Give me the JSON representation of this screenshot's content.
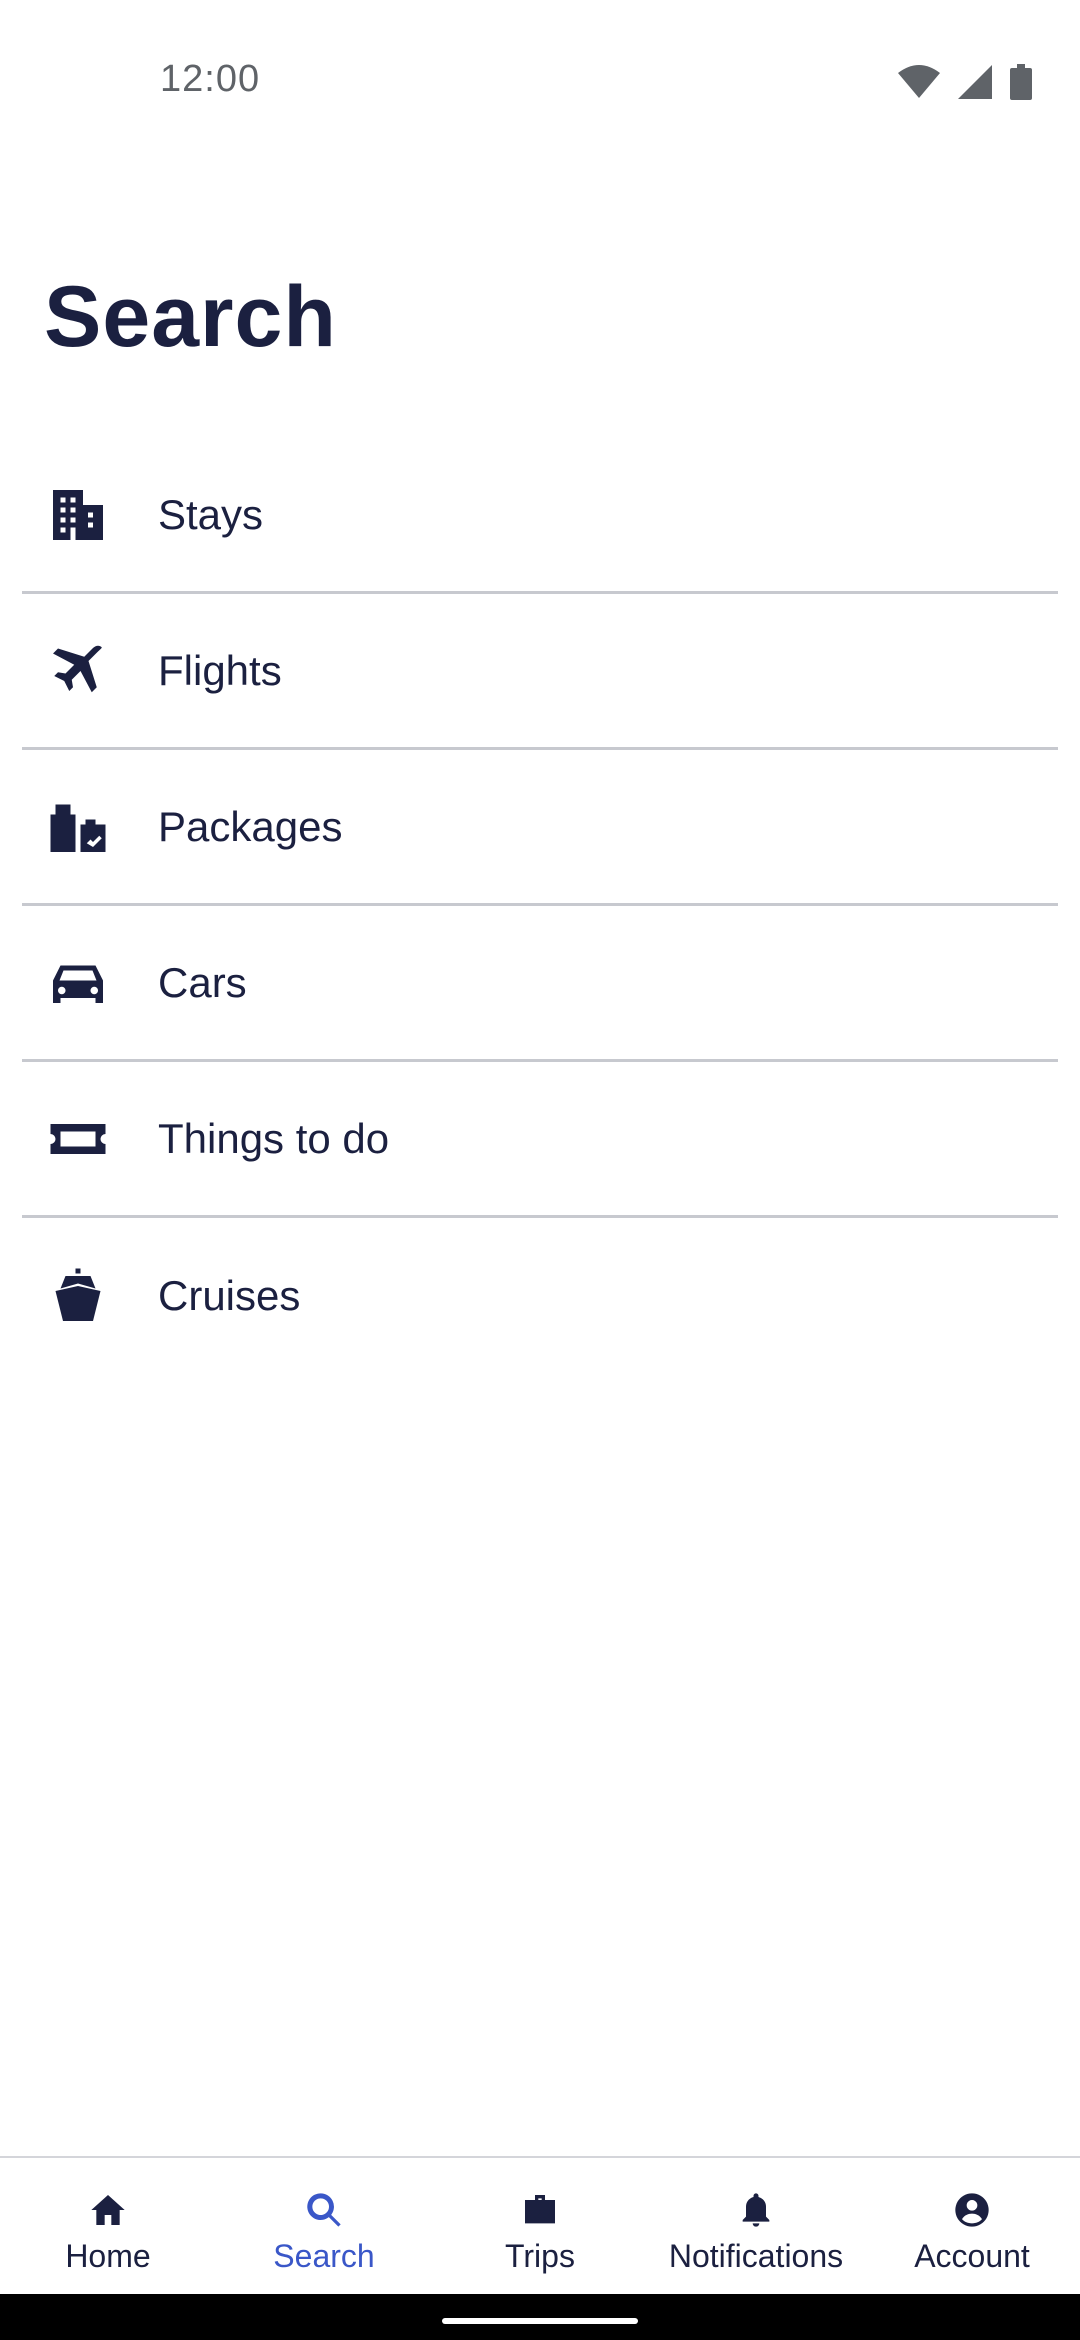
{
  "status_bar": {
    "time": "12:00",
    "icons": [
      "wifi-icon",
      "cellular-signal-icon",
      "battery-icon"
    ]
  },
  "page": {
    "title": "Search"
  },
  "search_options": [
    {
      "label": "Stays",
      "icon": "building-icon"
    },
    {
      "label": "Flights",
      "icon": "airplane-icon"
    },
    {
      "label": "Packages",
      "icon": "package-icon"
    },
    {
      "label": "Cars",
      "icon": "car-icon"
    },
    {
      "label": "Things to do",
      "icon": "ticket-icon"
    },
    {
      "label": "Cruises",
      "icon": "ship-icon"
    }
  ],
  "bottom_nav": {
    "items": [
      {
        "label": "Home",
        "icon": "home-icon"
      },
      {
        "label": "Search",
        "icon": "search-icon",
        "active": true
      },
      {
        "label": "Trips",
        "icon": "briefcase-icon"
      },
      {
        "label": "Notifications",
        "icon": "bell-icon"
      },
      {
        "label": "Account",
        "icon": "account-icon"
      }
    ]
  },
  "colors": {
    "text_primary": "#1b2040",
    "accent": "#3a57c8",
    "divider": "#c7c9cf",
    "status_text": "#5f6368"
  }
}
